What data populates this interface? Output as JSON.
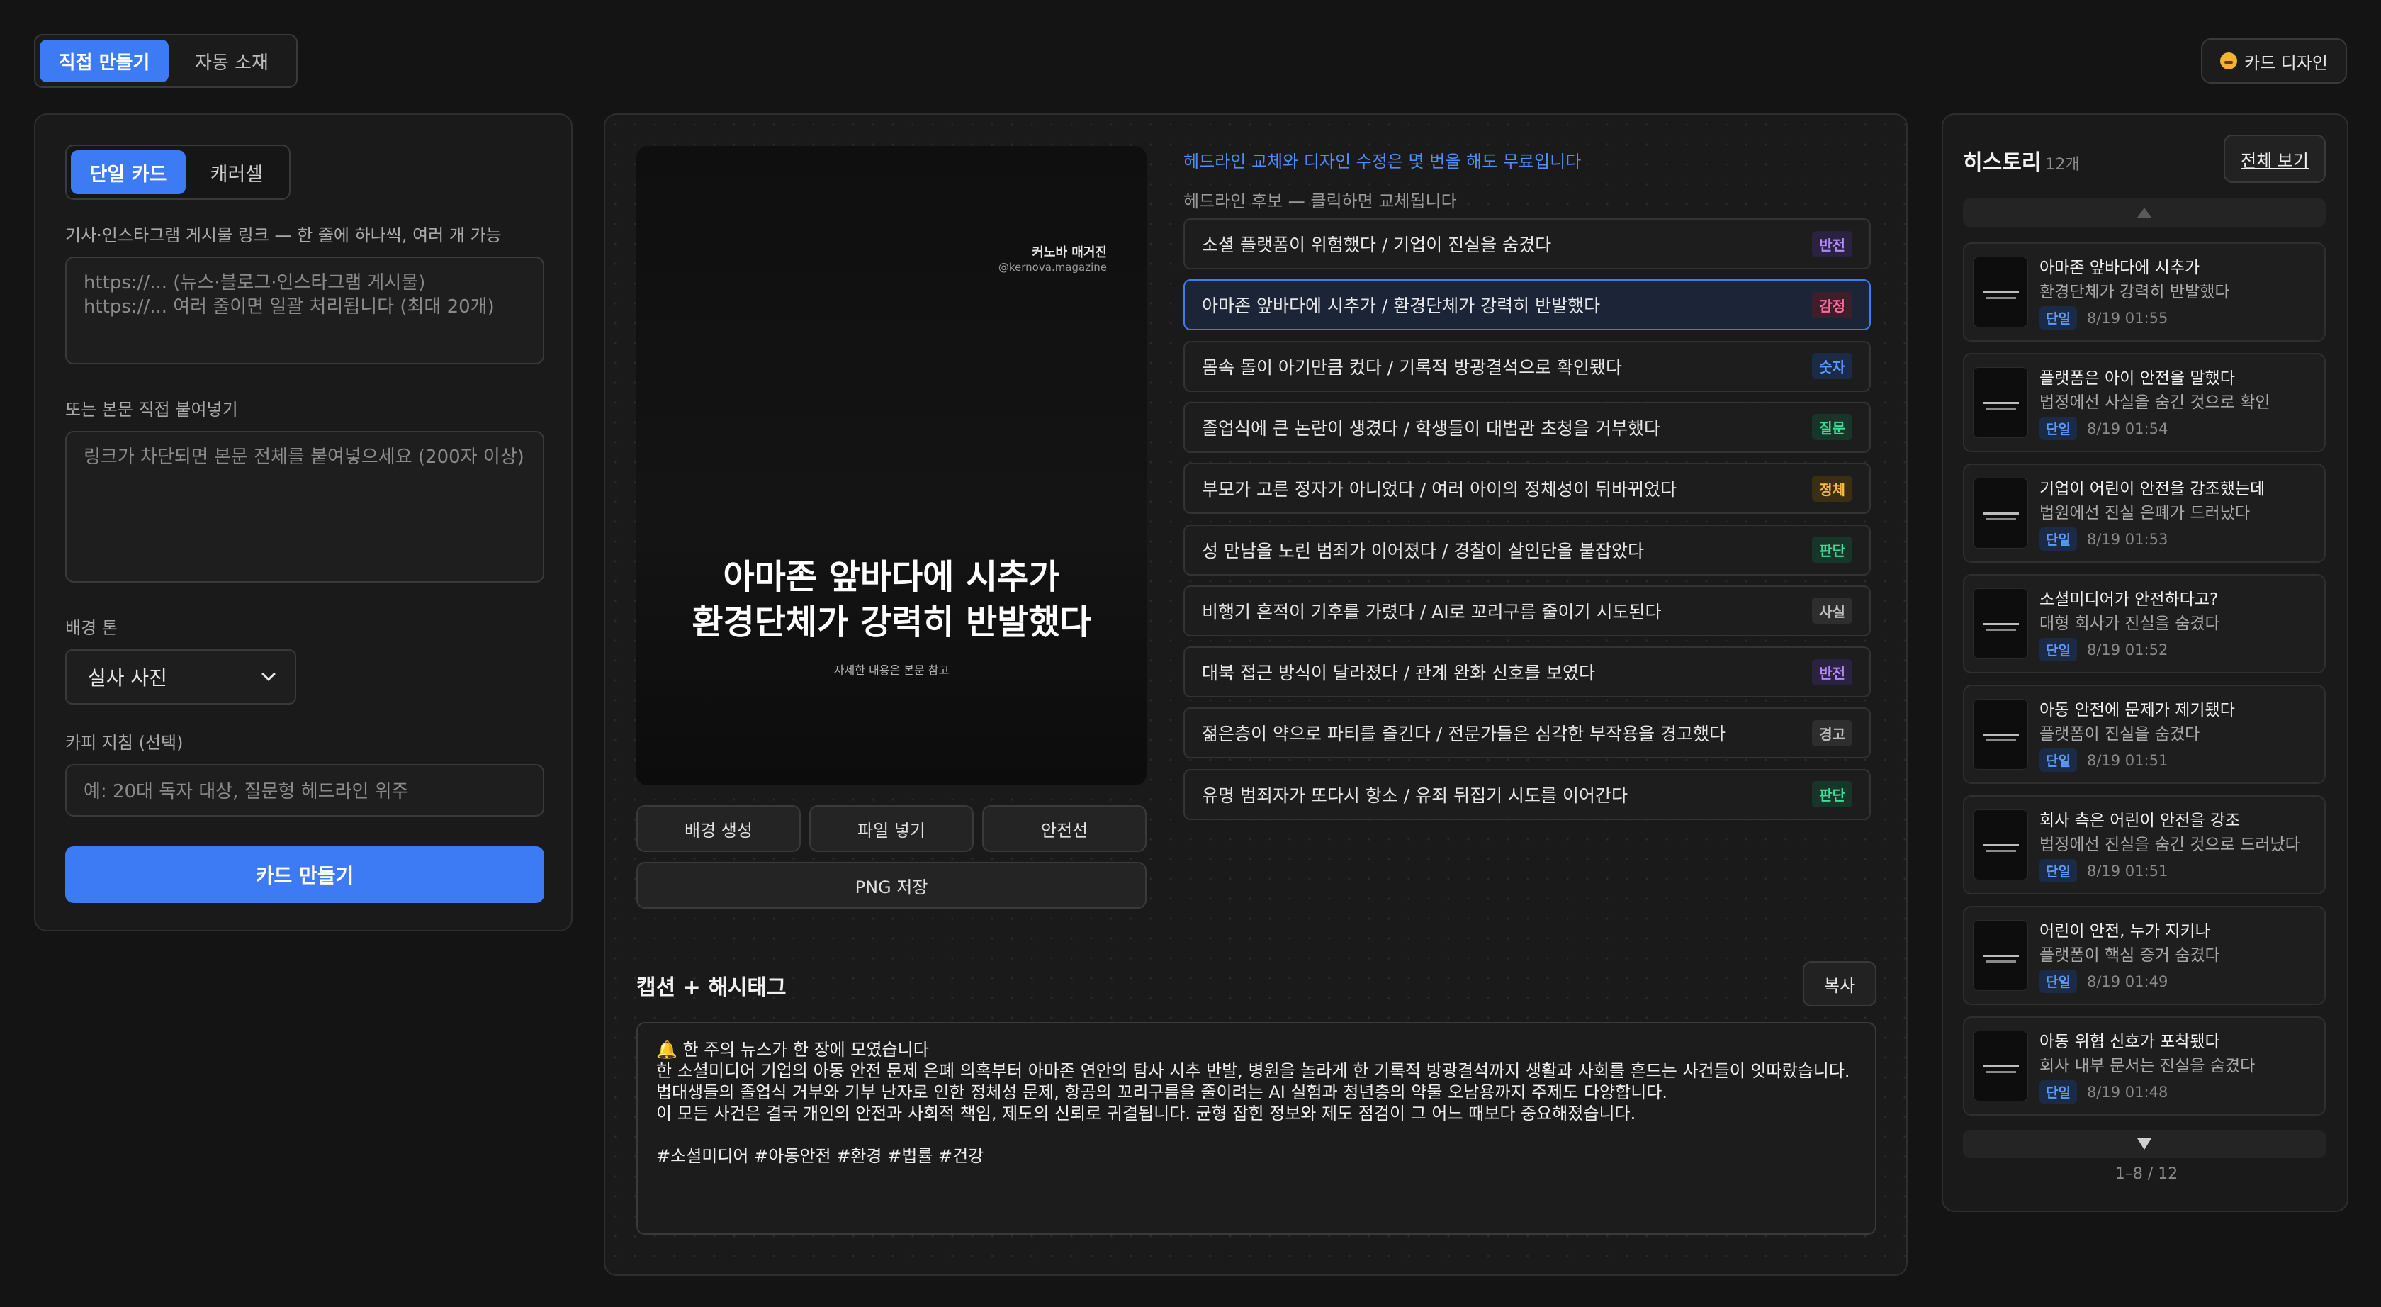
{
  "top": {
    "mode_tabs": [
      "직접 만들기",
      "자동 소재"
    ],
    "card_design_label": "카드 디자인"
  },
  "left": {
    "sub_tabs": [
      "단일 카드",
      "캐러셀"
    ],
    "link_label": "기사·인스타그램 게시물 링크 — 한 줄에 하나씩, 여러 개 가능",
    "link_placeholder": "https://...  (뉴스·블로그·인스타그램 게시물)\nhttps://...  여러 줄이면 일괄 처리됩니다 (최대 20개)",
    "body_label": "또는 본문 직접 붙여넣기",
    "body_placeholder": "링크가 차단되면 본문 전체를 붙여넣으세요 (200자 이상)",
    "tone_label": "배경 톤",
    "tone_value": "실사 사진",
    "copy_label": "카피 지침 (선택)",
    "copy_placeholder": "예: 20대 독자 대상, 질문형 헤드라인 위주",
    "make_button": "카드 만들기"
  },
  "preview": {
    "brand_name": "커노바 매거진",
    "brand_handle": "@kernova.magazine",
    "headline_line1": "아마존 앞바다에 시추가",
    "headline_line2": "환경단체가 강력히 반발했다",
    "sub": "자세한 내용은 본문 참고",
    "buttons": [
      "배경 생성",
      "파일 넣기",
      "안전선"
    ],
    "png_button": "PNG 저장"
  },
  "headlines": {
    "hint_free": "헤드라인 교체와 디자인 수정은 몇 번을 해도 무료입니다",
    "hint_click": "헤드라인 후보 — 클릭하면 교체됩니다",
    "items": [
      {
        "text": "소셜 플랫폼이 위험했다 / 기업이 진실을 숨겼다",
        "tag": "반전",
        "color": "#b388ff",
        "bg": "#2b2140"
      },
      {
        "text": "아마존 앞바다에 시추가 / 환경단체가 강력히 반발했다",
        "tag": "감정",
        "color": "#ff6b9a",
        "bg": "#3d1f2c"
      },
      {
        "text": "몸속 돌이 아기만큼 컸다 / 기록적 방광결석으로 확인됐다",
        "tag": "숫자",
        "color": "#5b9bff",
        "bg": "#1b2a45"
      },
      {
        "text": "졸업식에 큰 논란이 생겼다 / 학생들이 대법관 초청을 거부했다",
        "tag": "질문",
        "color": "#3ddc97",
        "bg": "#173528"
      },
      {
        "text": "부모가 고른 정자가 아니었다 / 여러 아이의 정체성이 뒤바뀌었다",
        "tag": "정체",
        "color": "#f5b942",
        "bg": "#3a2e14"
      },
      {
        "text": "성 만남을 노린 범죄가 이어졌다 / 경찰이 살인단을 붙잡았다",
        "tag": "판단",
        "color": "#3ddc97",
        "bg": "#173528"
      },
      {
        "text": "비행기 흔적이 기후를 가렸다 / AI로 꼬리구름 줄이기 시도된다",
        "tag": "사실",
        "color": "#bdbdbd",
        "bg": "#2e2e2e"
      },
      {
        "text": "대북 접근 방식이 달라졌다 / 관계 완화 신호를 보였다",
        "tag": "반전",
        "color": "#b388ff",
        "bg": "#2b2140"
      },
      {
        "text": "젊은층이 약으로 파티를 즐긴다 / 전문가들은 심각한 부작용을 경고했다",
        "tag": "경고",
        "color": "#bdbdbd",
        "bg": "#2e2e2e"
      },
      {
        "text": "유명 범죄자가 또다시 항소 / 유죄 뒤집기 시도를 이어간다",
        "tag": "판단",
        "color": "#3ddc97",
        "bg": "#173528"
      }
    ]
  },
  "caption": {
    "title": "캡션 + 해시태그",
    "copy_button": "복사",
    "lines": [
      "🔔 한 주의 뉴스가 한 장에 모였습니다",
      "한 소셜미디어 기업의 아동 안전 문제 은폐 의혹부터 아마존 연안의 탐사 시추 반발, 병원을 놀라게 한 기록적 방광결석까지 생활과 사회를 흔드는 사건들이 잇따랐습니다.",
      "법대생들의 졸업식 거부와 기부 난자로 인한 정체성 문제, 항공의 꼬리구름을 줄이려는 AI 실험과 청년층의 약물 오남용까지 주제도 다양합니다.",
      "이 모든 사건은 결국 개인의 안전과 사회적 책임, 제도의 신뢰로 귀결됩니다. 균형 잡힌 정보와 제도 점검이 그 어느 때보다 중요해졌습니다.",
      "",
      "#소셜미디어 #아동안전 #환경 #법률 #건강"
    ]
  },
  "history": {
    "title": "히스토리",
    "count": "12개",
    "view_all": "전체 보기",
    "page_info": "1–8 / 12",
    "items": [
      {
        "line1": "아마존 앞바다에 시추가",
        "line2": "환경단체가 강력히 반발했다",
        "tag": "단일",
        "time": "8/19 01:55"
      },
      {
        "line1": "플랫폼은 아이 안전을 말했다",
        "line2": "법정에선 사실을 숨긴 것으로 확인",
        "tag": "단일",
        "time": "8/19 01:54"
      },
      {
        "line1": "기업이 어린이 안전을 강조했는데",
        "line2": "법원에선 진실 은폐가 드러났다",
        "tag": "단일",
        "time": "8/19 01:53"
      },
      {
        "line1": "소셜미디어가 안전하다고?",
        "line2": "대형 회사가 진실을 숨겼다",
        "tag": "단일",
        "time": "8/19 01:52"
      },
      {
        "line1": "아동 안전에 문제가 제기됐다",
        "line2": "플랫폼이 진실을 숨겼다",
        "tag": "단일",
        "time": "8/19 01:51"
      },
      {
        "line1": "회사 측은 어린이 안전을 강조",
        "line2": "법정에선 진실을 숨긴 것으로 드러났다",
        "tag": "단일",
        "time": "8/19 01:51"
      },
      {
        "line1": "어린이 안전, 누가 지키나",
        "line2": "플랫폼이 핵심 증거 숨겼다",
        "tag": "단일",
        "time": "8/19 01:49"
      },
      {
        "line1": "아동 위협 신호가 포착됐다",
        "line2": "회사 내부 문서는 진실을 숨겼다",
        "tag": "단일",
        "time": "8/19 01:48"
      }
    ]
  }
}
